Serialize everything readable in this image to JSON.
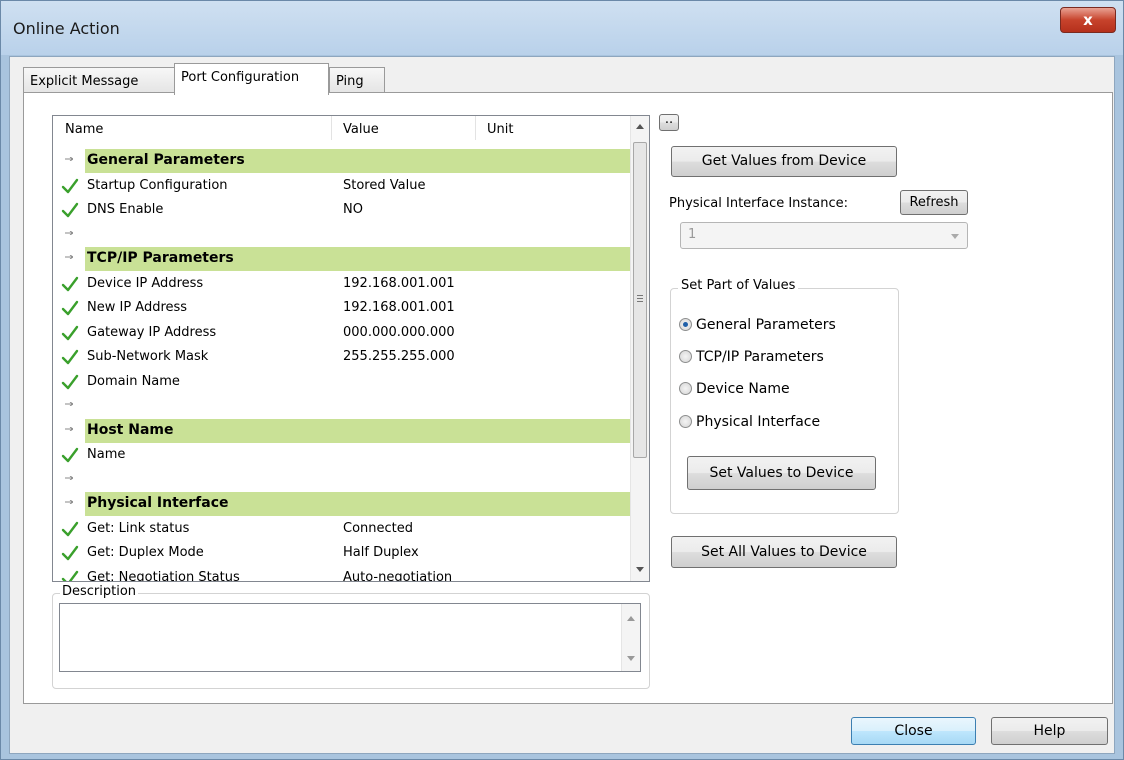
{
  "window": {
    "title": "Online Action",
    "close_glyph": "x"
  },
  "tabs": [
    {
      "label": "Explicit Message",
      "active": false
    },
    {
      "label": "Port Configuration",
      "active": true
    },
    {
      "label": "Ping",
      "active": false
    }
  ],
  "grid": {
    "columns": [
      "Name",
      "Value",
      "Unit"
    ],
    "rows": [
      {
        "type": "group",
        "name": "General Parameters",
        "value": ""
      },
      {
        "type": "item",
        "name": "Startup Configuration",
        "value": "Stored Value"
      },
      {
        "type": "item",
        "name": "DNS Enable",
        "value": "NO"
      },
      {
        "type": "spacer",
        "name": "",
        "value": ""
      },
      {
        "type": "group",
        "name": "TCP/IP Parameters",
        "value": ""
      },
      {
        "type": "item",
        "name": "Device IP Address",
        "value": "192.168.001.001"
      },
      {
        "type": "item",
        "name": "New IP Address",
        "value": "192.168.001.001"
      },
      {
        "type": "item",
        "name": "Gateway IP Address",
        "value": "000.000.000.000"
      },
      {
        "type": "item",
        "name": "Sub-Network Mask",
        "value": "255.255.255.000"
      },
      {
        "type": "item",
        "name": "Domain Name",
        "value": ""
      },
      {
        "type": "spacer",
        "name": "",
        "value": ""
      },
      {
        "type": "group",
        "name": "Host Name",
        "value": ""
      },
      {
        "type": "item",
        "name": "Name",
        "value": ""
      },
      {
        "type": "spacer",
        "name": "",
        "value": ""
      },
      {
        "type": "group",
        "name": "Physical Interface",
        "value": ""
      },
      {
        "type": "item",
        "name": "Get: Link status",
        "value": "Connected"
      },
      {
        "type": "item",
        "name": "Get: Duplex Mode",
        "value": "Half Duplex"
      },
      {
        "type": "item",
        "name": "Get: Negotiation Status",
        "value": "Auto-negotiation"
      }
    ]
  },
  "description": {
    "label": "Description",
    "text": ""
  },
  "right": {
    "ellipsis_label": "..",
    "get_values_label": "Get Values from Device",
    "phys_instance_label": "Physical Interface Instance:",
    "refresh_label": "Refresh",
    "instance_value": "1",
    "set_part_label": "Set Part of Values",
    "radios": [
      {
        "label": "General Parameters",
        "checked": true
      },
      {
        "label": "TCP/IP Parameters",
        "checked": false
      },
      {
        "label": "Device Name",
        "checked": false
      },
      {
        "label": "Physical Interface",
        "checked": false
      }
    ],
    "set_values_label": "Set Values to Device",
    "set_all_label": "Set All Values to Device"
  },
  "footer": {
    "close_label": "Close",
    "help_label": "Help"
  },
  "colors": {
    "group_bg": "#c9e196",
    "check_green": "#3aa02c",
    "accent_blue": "#3c8fd6"
  }
}
